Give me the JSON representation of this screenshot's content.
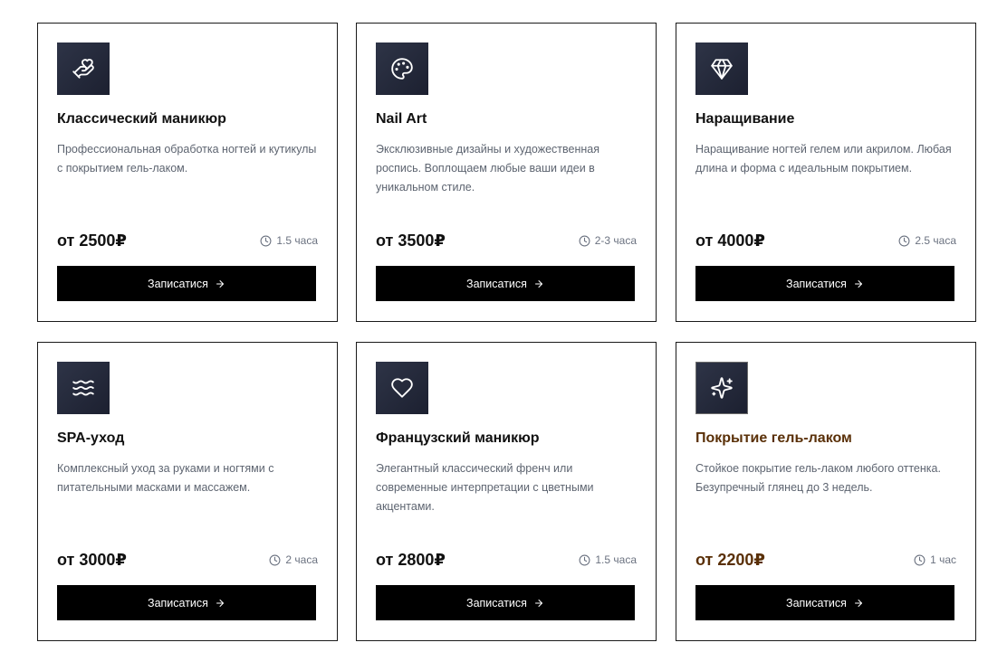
{
  "button_label": "Записатися",
  "services": [
    {
      "title": "Классический маникюр",
      "description": "Профессиональная обработка ногтей и кутикулы с покрытием гель-лаком.",
      "price": "от 2500₽",
      "duration": "1.5 часа",
      "icon": "hand-heart-icon"
    },
    {
      "title": "Nail Art",
      "description": "Эксклюзивные дизайны и художественная роспись. Воплощаем любые ваши идеи в уникальном стиле.",
      "price": "от 3500₽",
      "duration": "2-3 часа",
      "icon": "palette-icon"
    },
    {
      "title": "Наращивание",
      "description": "Наращивание ногтей гелем или акрилом. Любая длина и форма с идеальным покрытием.",
      "price": "от 4000₽",
      "duration": "2.5 часа",
      "icon": "gem-icon"
    },
    {
      "title": "SPA-уход",
      "description": "Комплексный уход за руками и ногтями с питательными масками и массажем.",
      "price": "от 3000₽",
      "duration": "2 часа",
      "icon": "waves-icon"
    },
    {
      "title": "Французский маникюр",
      "description": "Элегантный классический френч или современные интерпретации с цветными акцентами.",
      "price": "от 2800₽",
      "duration": "1.5 часа",
      "icon": "heart-icon"
    },
    {
      "title": "Покрытие гель-лаком",
      "description": "Стойкое покрытие гель-лаком любого оттенка. Безупречный глянец до 3 недель.",
      "price": "от 2200₽",
      "duration": "1 час",
      "icon": "sparkles-icon"
    }
  ],
  "colors": {
    "icon_background": "#2e3447",
    "button_background": "#000000",
    "accent_text": "#5a3008",
    "description_text": "#5d6470"
  }
}
